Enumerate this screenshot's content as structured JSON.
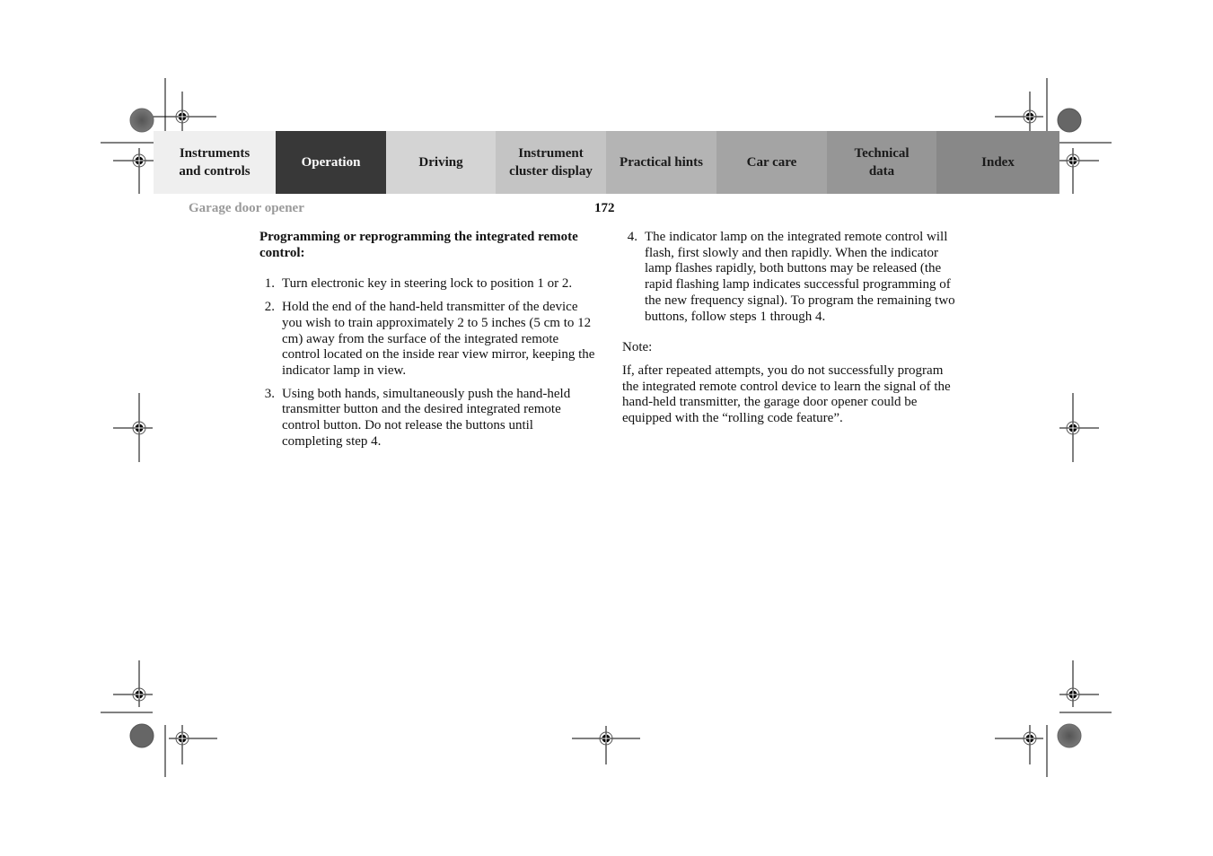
{
  "nav_tabs": [
    {
      "label": "Instruments\nand controls",
      "active": false
    },
    {
      "label": "Operation",
      "active": true
    },
    {
      "label": "Driving",
      "active": false
    },
    {
      "label": "Instrument\ncluster display",
      "active": false
    },
    {
      "label": "Practical hints",
      "active": false
    },
    {
      "label": "Car care",
      "active": false
    },
    {
      "label": "Technical\ndata",
      "active": false
    },
    {
      "label": "Index",
      "active": false
    }
  ],
  "header": {
    "section_title": "Garage door opener",
    "page_number": "172"
  },
  "content": {
    "heading": "Programming or reprogramming the integrated remote control:",
    "steps": [
      {
        "num": "1.",
        "text": "Turn electronic key in steering lock to position 1 or 2."
      },
      {
        "num": "2.",
        "text": "Hold the end of the hand-held transmitter of the device you wish to train approximately 2 to 5 inches (5 cm to 12 cm) away from the surface of the integrated remote control located on the inside rear view mirror, keeping the indicator lamp in view."
      },
      {
        "num": "3.",
        "text": "Using both hands, simultaneously push the hand-held transmitter button and the desired integrated remote control button. Do not release the buttons until completing step 4."
      },
      {
        "num": "4.",
        "text": "The indicator lamp on the integrated remote control will flash, first slowly and then rapidly. When the indicator lamp flashes rapidly, both buttons may be released (the rapid flashing lamp indicates successful programming of the new frequency signal). To program the remaining two buttons, follow steps 1 through 4."
      }
    ],
    "note_label": "Note:",
    "note_text": "If, after repeated attempts, you do not successfully program the integrated remote control device to learn the signal of the hand-held transmitter, the garage door opener could be equipped with the “rolling code feature”."
  },
  "icons": {
    "registration_mark": "crosshair-target-icon",
    "color_target": "star-target-icon"
  }
}
